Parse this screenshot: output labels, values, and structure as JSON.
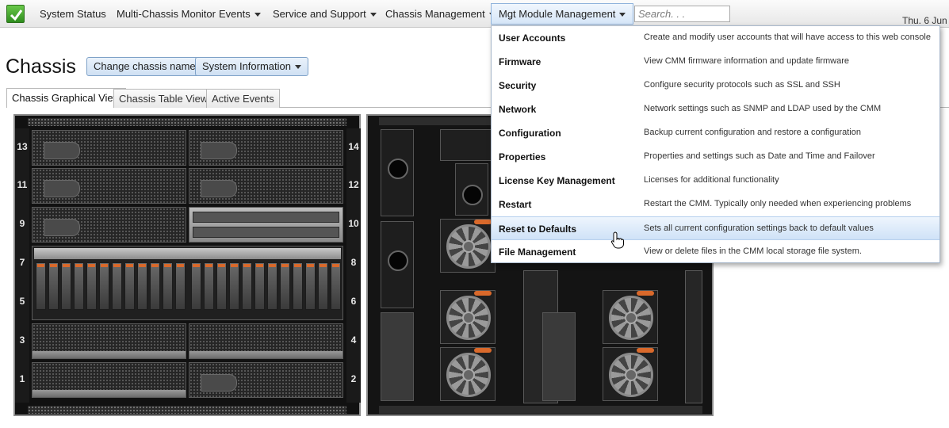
{
  "nav": {
    "items": [
      {
        "label": "System Status",
        "dropdown": false
      },
      {
        "label": "Multi-Chassis Monitor",
        "dropdown": false
      },
      {
        "label": "Events",
        "dropdown": true
      },
      {
        "label": "Service and Support",
        "dropdown": true
      },
      {
        "label": "Chassis Management",
        "dropdown": true
      },
      {
        "label": "Mgt Module Management",
        "dropdown": true,
        "active": true
      }
    ],
    "search_placeholder": "Search. . .",
    "date": "Thu. 6 Jun"
  },
  "page": {
    "title": "Chassis",
    "buttons": {
      "change_name": "Change chassis name",
      "system_info": "System Information"
    }
  },
  "tabs": [
    {
      "label": "Chassis Graphical View",
      "active": true
    },
    {
      "label": "Chassis Table View",
      "active": false
    },
    {
      "label": "Active Events",
      "active": false
    }
  ],
  "chassis": {
    "bays_left": [
      "13",
      "11",
      "9",
      "7",
      "5",
      "3",
      "1"
    ],
    "bays_right": [
      "14",
      "12",
      "10",
      "8",
      "6",
      "4",
      "2"
    ]
  },
  "menu": {
    "items": [
      {
        "label": "User Accounts",
        "desc": "Create and modify user accounts that will have access to this web console"
      },
      {
        "label": "Firmware",
        "desc": "View CMM firmware information and update firmware"
      },
      {
        "label": "Security",
        "desc": "Configure security protocols such as SSL and SSH"
      },
      {
        "label": "Network",
        "desc": "Network settings such as SNMP and LDAP used by the CMM"
      },
      {
        "label": "Configuration",
        "desc": "Backup current configuration and restore a configuration"
      },
      {
        "label": "Properties",
        "desc": "Properties and settings such as Date and Time and Failover"
      },
      {
        "label": "License Key Management",
        "desc": "Licenses for additional functionality"
      },
      {
        "label": "Restart",
        "desc": "Restart the CMM. Typically only needed when experiencing problems"
      },
      {
        "label": "Reset to Defaults",
        "desc": "Sets all current configuration settings back to default values",
        "hover": true
      },
      {
        "label": "File Management",
        "desc": "View or delete files in the CMM local storage file system."
      }
    ]
  },
  "colors": {
    "accent_blue": "#cfe0f3",
    "menu_hover": "#cfe2f7",
    "logo_green": "#3fa12b",
    "drive_orange": "#d9692b"
  }
}
